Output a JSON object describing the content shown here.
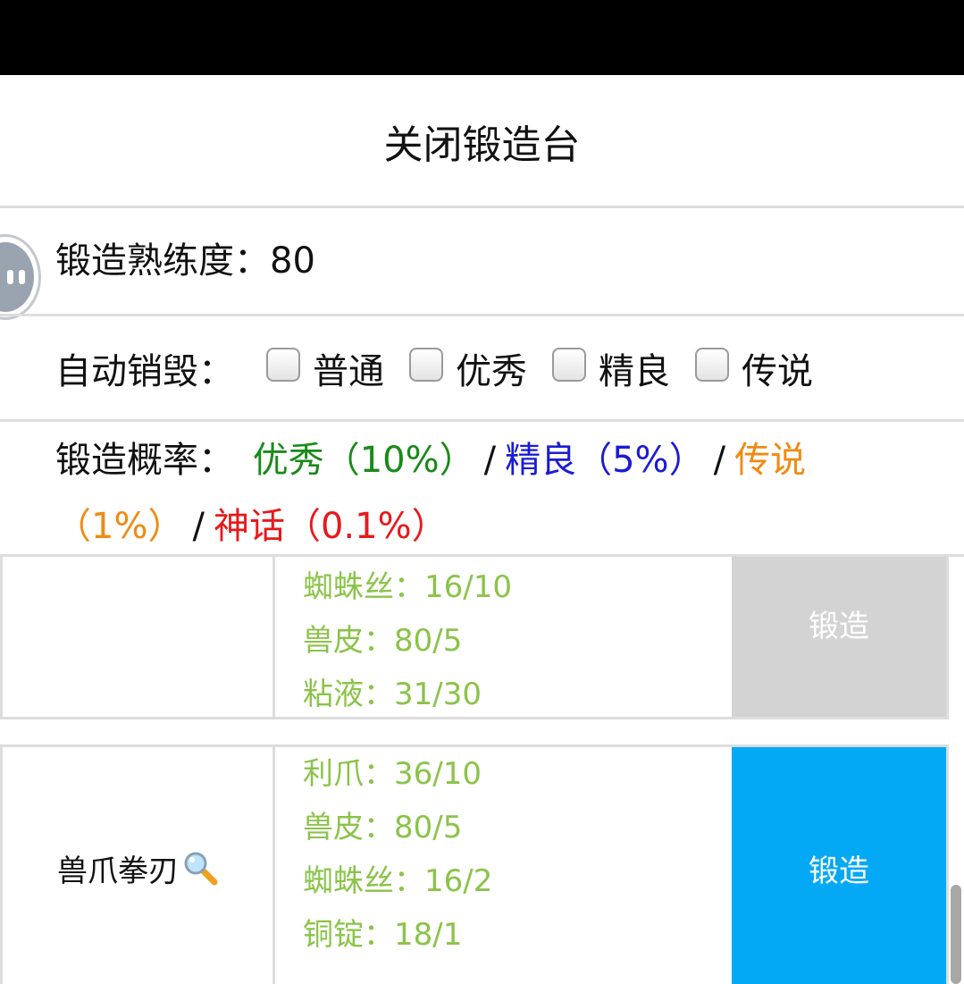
{
  "header": {
    "title": "关闭锻造台"
  },
  "mastery": {
    "label": "锻造熟练度：",
    "value": "80"
  },
  "auto_destroy": {
    "label": "自动销毁：",
    "options": [
      {
        "label": "普通",
        "checked": false
      },
      {
        "label": "优秀",
        "checked": false
      },
      {
        "label": "精良",
        "checked": false
      },
      {
        "label": "传说",
        "checked": false
      }
    ]
  },
  "rates": {
    "label": "锻造概率：",
    "separator": "/",
    "items": [
      {
        "text": "优秀（10%）",
        "color": "#1a8a1a"
      },
      {
        "text": "精良（5%）",
        "color": "#1b1bd6"
      },
      {
        "text": "传说（1%）",
        "color": "#f08a12"
      },
      {
        "text": "神话（0.1%）",
        "color": "#e8191b"
      }
    ]
  },
  "recipes": [
    {
      "name": "",
      "materials": [
        "蜘蛛丝：16/10",
        "兽皮：80/5",
        "粘液：31/30"
      ],
      "forge_label": "锻造",
      "available": false
    },
    {
      "name": "兽爪拳刃",
      "materials": [
        "利爪：36/10",
        "兽皮：80/5",
        "蜘蛛丝：16/2",
        "铜锭：18/1"
      ],
      "forge_label": "锻造",
      "available": true
    }
  ],
  "colors": {
    "material_text": "#8bc34a",
    "forge_active": "#03a9f4",
    "forge_disabled": "#d3d3d3"
  },
  "icons": {
    "magnifier": "magnifier-icon",
    "assistive_ball": "assistive-touch-icon"
  }
}
